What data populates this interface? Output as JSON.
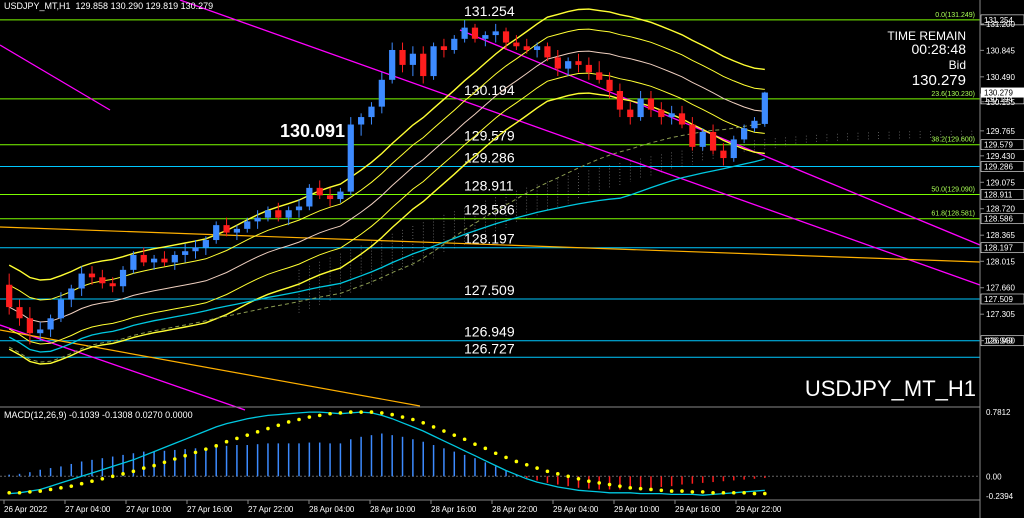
{
  "header": {
    "symbol": "USDJPY_MT,H1",
    "ohlc": "129.858 130.290 129.819 130.279",
    "macd": "MACD(12,26,9) -0.1039 -0.1308 0.0270 0.0000"
  },
  "timer": {
    "label": "TIME REMAIN",
    "value": "00:28:48",
    "bid_label": "Bid",
    "bid_value": "130.279"
  },
  "watermark": "USDJPY_MT_H1",
  "colors": {
    "background": "#000000",
    "bull": "#3d8bff",
    "bear": "#ff1e1e",
    "level_line": "#00c8ff",
    "fib_line": "#7cfc00",
    "bollinger": "#ffff33",
    "channel": "#ff00ff",
    "ma_long": "#00c8e0",
    "macd_signal": "#ffff00"
  },
  "chart_data": {
    "type": "candlestick",
    "y_range": [
      126.1,
      131.4
    ],
    "price_axis_ticks": [
      "131.200",
      "130.845",
      "130.490",
      "130.155",
      "129.765",
      "129.430",
      "129.075",
      "128.720",
      "128.365",
      "128.015",
      "127.660",
      "127.305",
      "126.950"
    ],
    "time_axis": [
      "26 Apr 2022",
      "27 Apr 04:00",
      "27 Apr 10:00",
      "27 Apr 16:00",
      "27 Apr 22:00",
      "28 Apr 04:00",
      "28 Apr 10:00",
      "28 Apr 16:00",
      "28 Apr 22:00",
      "29 Apr 04:00",
      "29 Apr 10:00",
      "29 Apr 16:00",
      "29 Apr 22:00"
    ],
    "candles": [
      [
        127.7,
        127.85,
        127.3,
        127.4
      ],
      [
        127.4,
        127.5,
        127.15,
        127.25
      ],
      [
        127.25,
        127.4,
        126.9,
        127.05
      ],
      [
        127.05,
        127.2,
        126.95,
        127.1
      ],
      [
        127.1,
        127.3,
        127.0,
        127.25
      ],
      [
        127.25,
        127.6,
        127.2,
        127.5
      ],
      [
        127.5,
        127.7,
        127.4,
        127.65
      ],
      [
        127.65,
        127.95,
        127.55,
        127.85
      ],
      [
        127.85,
        127.95,
        127.7,
        127.8
      ],
      [
        127.8,
        127.9,
        127.65,
        127.72
      ],
      [
        127.72,
        127.8,
        127.6,
        127.68
      ],
      [
        127.68,
        127.95,
        127.6,
        127.9
      ],
      [
        127.9,
        128.15,
        127.85,
        128.1
      ],
      [
        128.1,
        128.2,
        127.95,
        128.0
      ],
      [
        128.0,
        128.1,
        127.9,
        128.05
      ],
      [
        128.05,
        128.15,
        127.95,
        128.0
      ],
      [
        128.0,
        128.15,
        127.9,
        128.1
      ],
      [
        128.1,
        128.25,
        128.0,
        128.15
      ],
      [
        128.15,
        128.3,
        128.05,
        128.2
      ],
      [
        128.2,
        128.35,
        128.1,
        128.3
      ],
      [
        128.3,
        128.55,
        128.25,
        128.5
      ],
      [
        128.5,
        128.6,
        128.35,
        128.4
      ],
      [
        128.4,
        128.5,
        128.3,
        128.45
      ],
      [
        128.45,
        128.6,
        128.4,
        128.55
      ],
      [
        128.55,
        128.7,
        128.45,
        128.6
      ],
      [
        128.6,
        128.75,
        128.55,
        128.7
      ],
      [
        128.7,
        128.8,
        128.55,
        128.6
      ],
      [
        128.6,
        128.75,
        128.5,
        128.7
      ],
      [
        128.7,
        128.85,
        128.6,
        128.75
      ],
      [
        128.75,
        129.05,
        128.7,
        129.0
      ],
      [
        129.0,
        129.1,
        128.85,
        128.9
      ],
      [
        128.9,
        129.0,
        128.75,
        128.85
      ],
      [
        128.85,
        129.0,
        128.8,
        128.95
      ],
      [
        128.95,
        129.95,
        128.9,
        129.85
      ],
      [
        129.85,
        130.0,
        129.7,
        129.95
      ],
      [
        129.95,
        130.15,
        129.85,
        130.09
      ],
      [
        130.09,
        130.55,
        130.0,
        130.45
      ],
      [
        130.45,
        130.95,
        130.4,
        130.85
      ],
      [
        130.85,
        130.95,
        130.55,
        130.65
      ],
      [
        130.65,
        130.9,
        130.5,
        130.8
      ],
      [
        130.8,
        130.9,
        130.4,
        130.5
      ],
      [
        130.5,
        130.95,
        130.45,
        130.9
      ],
      [
        130.9,
        131.0,
        130.75,
        130.85
      ],
      [
        130.85,
        131.05,
        130.8,
        131.0
      ],
      [
        131.0,
        131.25,
        130.95,
        131.15
      ],
      [
        131.15,
        131.2,
        130.95,
        131.0
      ],
      [
        131.0,
        131.1,
        130.9,
        131.05
      ],
      [
        131.05,
        131.2,
        130.95,
        131.1
      ],
      [
        131.1,
        131.15,
        130.85,
        130.95
      ],
      [
        130.95,
        131.05,
        130.85,
        130.9
      ],
      [
        130.9,
        131.0,
        130.8,
        130.85
      ],
      [
        130.85,
        130.95,
        130.75,
        130.9
      ],
      [
        130.9,
        130.95,
        130.7,
        130.75
      ],
      [
        130.75,
        130.85,
        130.5,
        130.6
      ],
      [
        130.6,
        130.75,
        130.5,
        130.7
      ],
      [
        130.7,
        130.8,
        130.55,
        130.65
      ],
      [
        130.65,
        130.75,
        130.45,
        130.55
      ],
      [
        130.55,
        130.7,
        130.4,
        130.45
      ],
      [
        130.45,
        130.55,
        130.2,
        130.3
      ],
      [
        130.3,
        130.4,
        129.95,
        130.05
      ],
      [
        130.05,
        130.15,
        129.85,
        129.95
      ],
      [
        129.95,
        130.3,
        129.9,
        130.2
      ],
      [
        130.2,
        130.3,
        129.95,
        130.05
      ],
      [
        130.05,
        130.15,
        129.85,
        129.95
      ],
      [
        129.95,
        130.1,
        129.85,
        130.0
      ],
      [
        130.0,
        130.1,
        129.8,
        129.85
      ],
      [
        129.85,
        129.95,
        129.5,
        129.55
      ],
      [
        129.55,
        129.8,
        129.5,
        129.75
      ],
      [
        129.75,
        129.85,
        129.45,
        129.5
      ],
      [
        129.5,
        129.6,
        129.3,
        129.4
      ],
      [
        129.4,
        129.7,
        129.35,
        129.65
      ],
      [
        129.65,
        129.85,
        129.6,
        129.8
      ],
      [
        129.8,
        129.95,
        129.75,
        129.9
      ],
      [
        129.858,
        130.29,
        129.819,
        130.279
      ]
    ],
    "price_levels": [
      {
        "value": "131.254",
        "label": "131.254",
        "tag": "131.254",
        "fib": "0.0(131.249)"
      },
      {
        "value": "130.194",
        "label": "130.194",
        "tag": "130.194",
        "fib": "23.6(130.230)"
      },
      {
        "value": "129.579",
        "label": "129.579",
        "tag": "129.579",
        "fib": "38.2(129.600)"
      },
      {
        "value": "129.286",
        "label": "129.286",
        "tag": "129.286",
        "fib": ""
      },
      {
        "value": "128.911",
        "label": "128.911",
        "tag": "128.911",
        "fib": "50.0(129.090)"
      },
      {
        "value": "128.586",
        "label": "128.586",
        "tag": "128.586",
        "fib": "61.8(128.581)"
      },
      {
        "value": "128.197",
        "label": "128.197",
        "tag": "128.197",
        "fib": ""
      },
      {
        "value": "127.509",
        "label": "127.509",
        "tag": "127.509",
        "fib": ""
      },
      {
        "value": "126.949",
        "label": "126.949",
        "tag": "126.949",
        "fib": ""
      },
      {
        "value": "126.727",
        "label": "126.727",
        "tag": "",
        "fib": ""
      }
    ],
    "current_price": "130.279",
    "annotation": "130.091",
    "macd": {
      "axis_ticks": [
        "0.7812",
        "0.00",
        "-0.2394"
      ],
      "range": [
        -0.2394,
        0.7812
      ],
      "histogram": [
        0.02,
        0.03,
        0.05,
        0.08,
        0.1,
        0.12,
        0.15,
        0.18,
        0.2,
        0.22,
        0.24,
        0.26,
        0.28,
        0.3,
        0.3,
        0.31,
        0.32,
        0.33,
        0.34,
        0.35,
        0.36,
        0.37,
        0.38,
        0.38,
        0.39,
        0.4,
        0.4,
        0.4,
        0.4,
        0.41,
        0.41,
        0.4,
        0.4,
        0.45,
        0.48,
        0.5,
        0.52,
        0.5,
        0.48,
        0.45,
        0.42,
        0.38,
        0.34,
        0.3,
        0.26,
        0.22,
        0.17,
        0.12,
        0.07,
        0.02,
        -0.02,
        -0.05,
        -0.08,
        -0.1,
        -0.12,
        -0.14,
        -0.15,
        -0.16,
        -0.16,
        -0.16,
        -0.16,
        -0.15,
        -0.14,
        -0.13,
        -0.12,
        -0.1,
        -0.09,
        -0.08,
        -0.07,
        -0.06,
        -0.05,
        -0.04,
        -0.03,
        -0.02
      ],
      "signal": [
        -0.2,
        -0.2,
        -0.19,
        -0.18,
        -0.16,
        -0.14,
        -0.12,
        -0.09,
        -0.06,
        -0.03,
        0.0,
        0.03,
        0.06,
        0.1,
        0.13,
        0.17,
        0.21,
        0.25,
        0.29,
        0.33,
        0.37,
        0.42,
        0.46,
        0.5,
        0.54,
        0.58,
        0.62,
        0.66,
        0.69,
        0.72,
        0.74,
        0.76,
        0.77,
        0.78,
        0.78,
        0.78,
        0.77,
        0.75,
        0.72,
        0.69,
        0.65,
        0.6,
        0.55,
        0.5,
        0.45,
        0.39,
        0.34,
        0.28,
        0.23,
        0.18,
        0.14,
        0.1,
        0.06,
        0.03,
        0.0,
        -0.03,
        -0.06,
        -0.08,
        -0.1,
        -0.12,
        -0.14,
        -0.15,
        -0.16,
        -0.17,
        -0.18,
        -0.18,
        -0.19,
        -0.19,
        -0.2,
        -0.2,
        -0.2,
        -0.2,
        -0.21,
        -0.21
      ],
      "macd_line": [
        -0.21,
        -0.2,
        -0.18,
        -0.16,
        -0.12,
        -0.08,
        -0.04,
        0.0,
        0.04,
        0.08,
        0.12,
        0.16,
        0.2,
        0.25,
        0.3,
        0.35,
        0.4,
        0.45,
        0.5,
        0.55,
        0.6,
        0.64,
        0.67,
        0.7,
        0.72,
        0.74,
        0.75,
        0.76,
        0.77,
        0.78,
        0.78,
        0.77,
        0.76,
        0.77,
        0.78,
        0.77,
        0.74,
        0.7,
        0.65,
        0.6,
        0.55,
        0.49,
        0.43,
        0.37,
        0.31,
        0.25,
        0.19,
        0.13,
        0.07,
        0.02,
        -0.03,
        -0.07,
        -0.1,
        -0.13,
        -0.15,
        -0.17,
        -0.18,
        -0.19,
        -0.2,
        -0.2,
        -0.2,
        -0.21,
        -0.21,
        -0.21,
        -0.22,
        -0.22,
        -0.22,
        -0.23,
        -0.22,
        -0.21,
        -0.2,
        -0.19,
        -0.18,
        -0.17
      ]
    }
  }
}
